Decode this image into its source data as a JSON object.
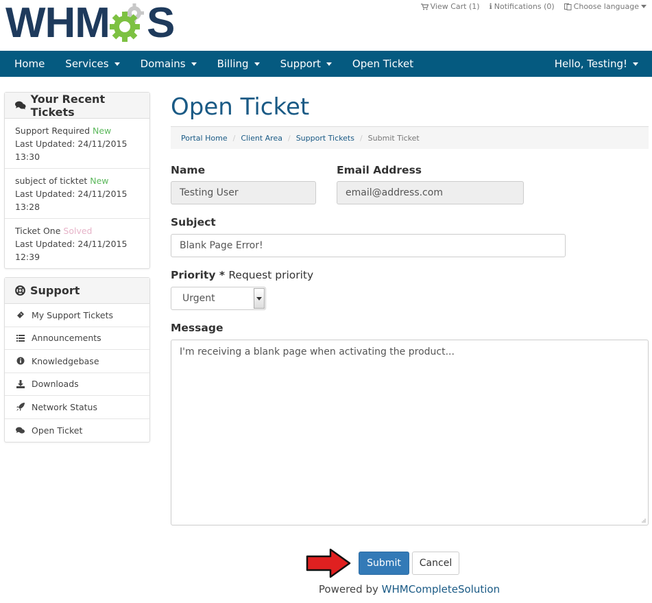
{
  "brand": {
    "logo_left": "WHM",
    "logo_right": "S"
  },
  "top_links": [
    {
      "label": "View Cart (1)",
      "icon": "cart-icon"
    },
    {
      "label": "Notifications (0)",
      "icon": "info-icon"
    },
    {
      "label": "Choose language",
      "icon": "language-icon"
    }
  ],
  "nav": {
    "items": [
      {
        "label": "Home",
        "dropdown": false
      },
      {
        "label": "Services",
        "dropdown": true
      },
      {
        "label": "Domains",
        "dropdown": true
      },
      {
        "label": "Billing",
        "dropdown": true
      },
      {
        "label": "Support",
        "dropdown": true
      },
      {
        "label": "Open Ticket",
        "dropdown": false
      }
    ],
    "user": "Hello, Testing!"
  },
  "recent_tickets": {
    "title": "Your Recent Tickets",
    "items": [
      {
        "subject": "Support Required",
        "status": "New",
        "updated_label": "Last Updated: 24/11/2015",
        "time": "13:30"
      },
      {
        "subject": "subject of ticktet",
        "status": "New",
        "updated_label": "Last Updated: 24/11/2015",
        "time": "13:28"
      },
      {
        "subject": "Ticket One",
        "status": "Solved",
        "updated_label": "Last Updated: 24/11/2015",
        "time": "12:39"
      }
    ]
  },
  "support_panel": {
    "title": "Support",
    "items": [
      {
        "label": "My Support Tickets",
        "icon": "ticket-icon"
      },
      {
        "label": "Announcements",
        "icon": "list-icon"
      },
      {
        "label": "Knowledgebase",
        "icon": "info-circle-icon"
      },
      {
        "label": "Downloads",
        "icon": "download-icon"
      },
      {
        "label": "Network Status",
        "icon": "rocket-icon"
      },
      {
        "label": "Open Ticket",
        "icon": "comments-icon"
      }
    ]
  },
  "page": {
    "title": "Open Ticket",
    "breadcrumb": [
      "Portal Home",
      "Client Area",
      "Support Tickets",
      "Submit Ticket"
    ]
  },
  "form": {
    "name_label": "Name",
    "name_value": "Testing User",
    "email_label": "Email Address",
    "email_value": "email@address.com",
    "subject_label": "Subject",
    "subject_value": "Blank Page Error!",
    "priority_label": "Priority *",
    "priority_hint": "Request priority",
    "priority_value": "Urgent",
    "message_label": "Message",
    "message_value": "I'm receiving a blank page when activating the product...",
    "submit_label": "Submit",
    "cancel_label": "Cancel"
  },
  "footer": {
    "prefix": "Powered by",
    "link": "WHMCompleteSolution"
  },
  "colors": {
    "nav_bg": "#055a80",
    "title": "#1a5a85",
    "primary": "#337ab7",
    "status_new": "#5cb85c",
    "status_solved": "#e6b3c8",
    "annotation_arrow": "#e02020"
  }
}
